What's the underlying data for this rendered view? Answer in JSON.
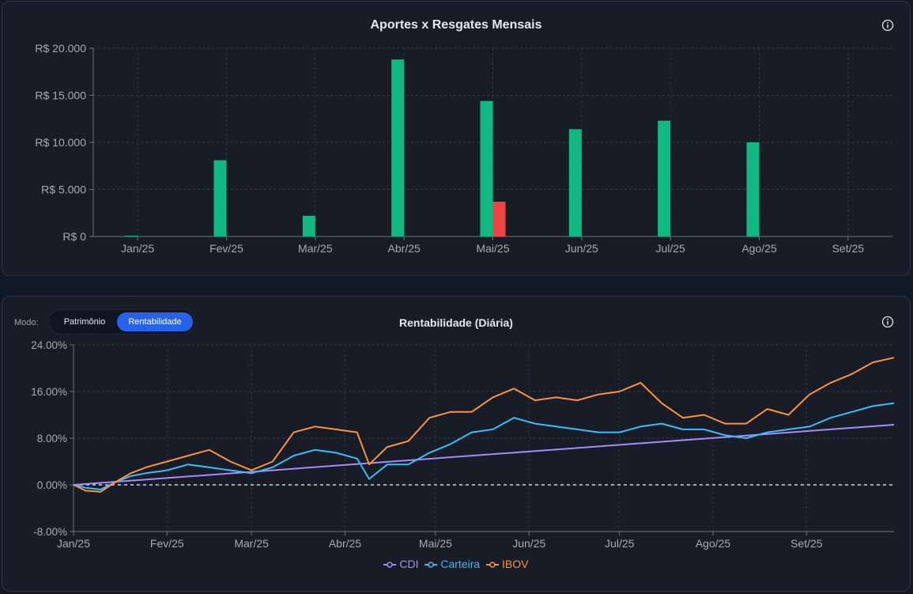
{
  "bar_panel": {
    "title": "Aportes x Resgates Mensais",
    "info_icon": "info-icon"
  },
  "line_panel": {
    "title": "Rentabilidade (Diária)",
    "info_icon": "info-icon",
    "mode_label": "Modo:",
    "mode_options": [
      "Patrimônio",
      "Rentabilidade"
    ],
    "mode_selected": "Rentabilidade"
  },
  "colors": {
    "aporte": "#10b981",
    "resgate": "#ef4444",
    "cdi": "#a78bfa",
    "carteira": "#38bdf8",
    "ibov": "#fb923c",
    "toggle_active": "#2563eb"
  },
  "chart_data": [
    {
      "type": "bar",
      "title": "Aportes x Resgates Mensais",
      "categories": [
        "Jan/25",
        "Fev/25",
        "Mar/25",
        "Abr/25",
        "Mai/25",
        "Jun/25",
        "Jul/25",
        "Ago/25",
        "Set/25"
      ],
      "series": [
        {
          "key": "aporte",
          "values": [
            0,
            8100,
            2200,
            18800,
            14400,
            11400,
            12300,
            10000,
            0
          ]
        },
        {
          "key": "resgate",
          "values": [
            0,
            0,
            0,
            0,
            3700,
            0,
            0,
            0,
            0
          ]
        }
      ],
      "ylim": [
        0,
        20000
      ],
      "yticks": [
        0,
        5000,
        10000,
        15000,
        20000
      ],
      "ytick_labels": [
        "R$ 0",
        "R$ 5.000",
        "R$ 10.000",
        "R$ 15.000",
        "R$ 20.000"
      ],
      "grid": true
    },
    {
      "type": "line",
      "title": "Rentabilidade (Diária)",
      "x_tick_labels": [
        "Jan/25",
        "Fev/25",
        "Mar/25",
        "Abr/25",
        "Mai/25",
        "Jun/25",
        "Jul/25",
        "Ago/25",
        "Set/25"
      ],
      "x_tick_dates": [
        "2025-01-01",
        "2025-02-01",
        "2025-03-01",
        "2025-04-01",
        "2025-05-01",
        "2025-06-01",
        "2025-07-01",
        "2025-08-01",
        "2025-09-01"
      ],
      "x_range": [
        "2025-01-01",
        "2025-09-30"
      ],
      "ylim": [
        -8,
        24
      ],
      "yticks": [
        -8,
        0,
        8,
        16,
        24
      ],
      "ytick_labels": [
        "-8.00%",
        "0.00%",
        "8.00%",
        "16.00%",
        "24.00%"
      ],
      "zero_line": "dashed",
      "legend_position": "bottom",
      "grid": true,
      "series": [
        {
          "name": "CDI",
          "key": "cdi",
          "x": [
            "2025-01-01",
            "2025-09-30"
          ],
          "y": [
            0.0,
            10.3
          ]
        },
        {
          "name": "Carteira",
          "key": "carteira",
          "x": [
            "2025-01-01",
            "2025-01-05",
            "2025-01-10",
            "2025-01-15",
            "2025-01-20",
            "2025-01-25",
            "2025-02-01",
            "2025-02-08",
            "2025-02-15",
            "2025-02-22",
            "2025-03-01",
            "2025-03-08",
            "2025-03-15",
            "2025-03-22",
            "2025-03-29",
            "2025-04-05",
            "2025-04-09",
            "2025-04-15",
            "2025-04-22",
            "2025-04-29",
            "2025-05-06",
            "2025-05-13",
            "2025-05-20",
            "2025-05-27",
            "2025-06-03",
            "2025-06-10",
            "2025-06-17",
            "2025-06-24",
            "2025-07-01",
            "2025-07-08",
            "2025-07-15",
            "2025-07-22",
            "2025-07-29",
            "2025-08-05",
            "2025-08-12",
            "2025-08-19",
            "2025-08-26",
            "2025-09-02",
            "2025-09-09",
            "2025-09-16",
            "2025-09-23",
            "2025-09-30"
          ],
          "y": [
            0.0,
            -0.5,
            -0.8,
            0.5,
            1.5,
            2.0,
            2.5,
            3.5,
            3.0,
            2.5,
            2.0,
            3.0,
            5.0,
            6.0,
            5.5,
            4.5,
            1.0,
            3.5,
            3.5,
            5.5,
            7.0,
            9.0,
            9.5,
            11.5,
            10.5,
            10.0,
            9.5,
            9.0,
            9.0,
            10.0,
            10.5,
            9.5,
            9.5,
            8.5,
            8.0,
            9.0,
            9.5,
            10.0,
            11.5,
            12.5,
            13.5,
            14.0
          ]
        },
        {
          "name": "IBOV",
          "key": "ibov",
          "x": [
            "2025-01-01",
            "2025-01-05",
            "2025-01-10",
            "2025-01-15",
            "2025-01-20",
            "2025-01-25",
            "2025-02-01",
            "2025-02-08",
            "2025-02-15",
            "2025-02-22",
            "2025-03-01",
            "2025-03-08",
            "2025-03-15",
            "2025-03-22",
            "2025-03-29",
            "2025-04-05",
            "2025-04-09",
            "2025-04-15",
            "2025-04-22",
            "2025-04-29",
            "2025-05-06",
            "2025-05-13",
            "2025-05-20",
            "2025-05-27",
            "2025-06-03",
            "2025-06-10",
            "2025-06-17",
            "2025-06-24",
            "2025-07-01",
            "2025-07-08",
            "2025-07-15",
            "2025-07-22",
            "2025-07-29",
            "2025-08-05",
            "2025-08-12",
            "2025-08-19",
            "2025-08-26",
            "2025-09-02",
            "2025-09-09",
            "2025-09-16",
            "2025-09-23",
            "2025-09-30"
          ],
          "y": [
            0.0,
            -1.0,
            -1.2,
            0.5,
            2.0,
            3.0,
            4.0,
            5.0,
            6.0,
            4.0,
            2.5,
            4.0,
            9.0,
            10.0,
            9.5,
            9.0,
            3.5,
            6.5,
            7.5,
            11.5,
            12.5,
            12.5,
            15.0,
            16.5,
            14.5,
            15.0,
            14.5,
            15.5,
            16.0,
            17.5,
            14.0,
            11.5,
            12.0,
            10.5,
            10.5,
            13.0,
            12.0,
            15.5,
            17.5,
            19.0,
            21.0,
            21.8
          ]
        }
      ]
    }
  ]
}
